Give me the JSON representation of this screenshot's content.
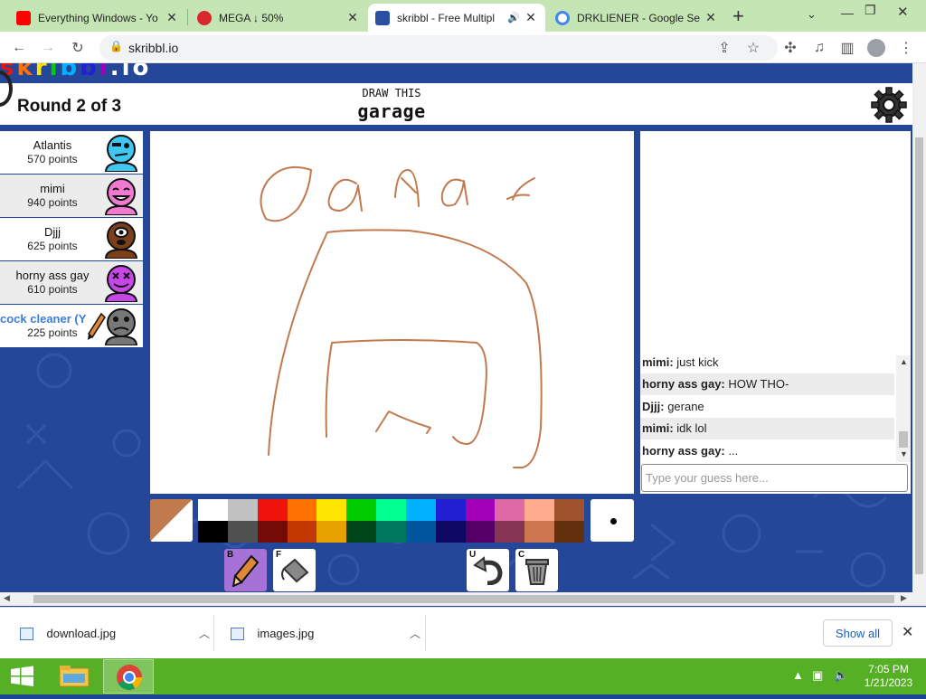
{
  "browser": {
    "tabs": [
      {
        "title": "Everything Windows - Yo",
        "favicon": "youtube-icon",
        "color": "#ff0000"
      },
      {
        "title": "MEGA ↓ 50%",
        "favicon": "mega-icon",
        "color": "#d9272e"
      },
      {
        "title": "skribbl - Free Multipl",
        "favicon": "skribbl-icon",
        "color": "#2b4fa3",
        "active": true
      },
      {
        "title": "DRKLIENER - Google Sea",
        "favicon": "google-icon",
        "color": "#4285f4"
      }
    ],
    "new_tab": "+",
    "url": "skribbl.io"
  },
  "game": {
    "round": "Round 2 of 3",
    "draw_label": "DRAW THIS",
    "word": "garage",
    "more_label": "...",
    "players": [
      {
        "name": "Atlantis",
        "points": "570 points",
        "avatar_color": "#3fc7f2"
      },
      {
        "name": "mimi",
        "points": "940 points",
        "avatar_color": "#f07ad0"
      },
      {
        "name": "Djjj",
        "points": "625 points",
        "avatar_color": "#7b3f1c"
      },
      {
        "name": "horny ass gay",
        "points": "610 points",
        "avatar_color": "#c646e6"
      },
      {
        "name": "cock cleaner (Y",
        "points": "225 points",
        "avatar_color": "#777777",
        "is_you": true
      }
    ],
    "chat": [
      {
        "author": "mimi:",
        "text": "just kick"
      },
      {
        "author": "horny ass gay:",
        "text": "HOW THO-"
      },
      {
        "author": "Djjj:",
        "text": "gerane"
      },
      {
        "author": "mimi:",
        "text": "idk lol"
      },
      {
        "author": "horny ass gay:",
        "text": "..."
      }
    ],
    "guess_placeholder": "Type your guess here...",
    "current_color": "#c17a4e",
    "palette": [
      "#ffffff",
      "#c1c1c1",
      "#ef130b",
      "#ff7100",
      "#ffe400",
      "#00cc00",
      "#00ff91",
      "#00b2ff",
      "#231fd3",
      "#a300ba",
      "#df69a7",
      "#ffac8e",
      "#a0522d",
      "#000000",
      "#505050",
      "#740b07",
      "#c23800",
      "#e8a200",
      "#004619",
      "#00785d",
      "#00569e",
      "#0e0865",
      "#550069",
      "#873554",
      "#cc774d",
      "#63300d"
    ],
    "tools": [
      {
        "key": "B",
        "name": "brush",
        "selected": true
      },
      {
        "key": "F",
        "name": "fill"
      },
      {
        "key": "U",
        "name": "undo"
      },
      {
        "key": "C",
        "name": "clear"
      }
    ]
  },
  "downloads": {
    "items": [
      "download.jpg",
      "images.jpg"
    ],
    "show_all": "Show all"
  },
  "taskbar": {
    "time": "7:05 PM",
    "date": "1/21/2023"
  }
}
